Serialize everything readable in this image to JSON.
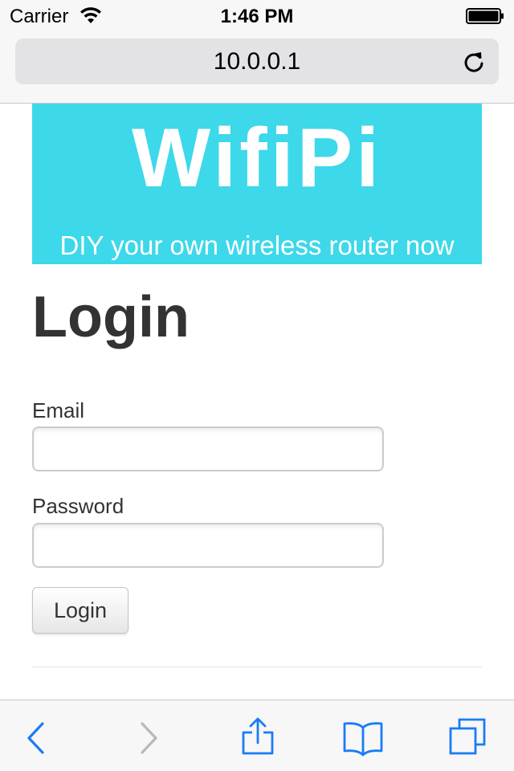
{
  "status_bar": {
    "carrier": "Carrier",
    "time": "1:46 PM",
    "icons": [
      "wifi-icon",
      "battery-icon"
    ]
  },
  "browser": {
    "url": "10.0.0.1",
    "reload_icon": "reload-icon",
    "toolbar_icons": [
      "back-icon",
      "forward-icon",
      "share-icon",
      "bookmarks-icon",
      "tabs-icon"
    ],
    "accent_color": "#1a7cf4",
    "disabled_color": "#b8b8bd"
  },
  "banner": {
    "title": "WifiPi",
    "subtitle": "DIY your own wireless router now",
    "background": "#3dd8ea"
  },
  "page": {
    "title": "Login"
  },
  "form": {
    "email_label": "Email",
    "email_value": "",
    "password_label": "Password",
    "password_value": "",
    "submit_label": "Login"
  }
}
